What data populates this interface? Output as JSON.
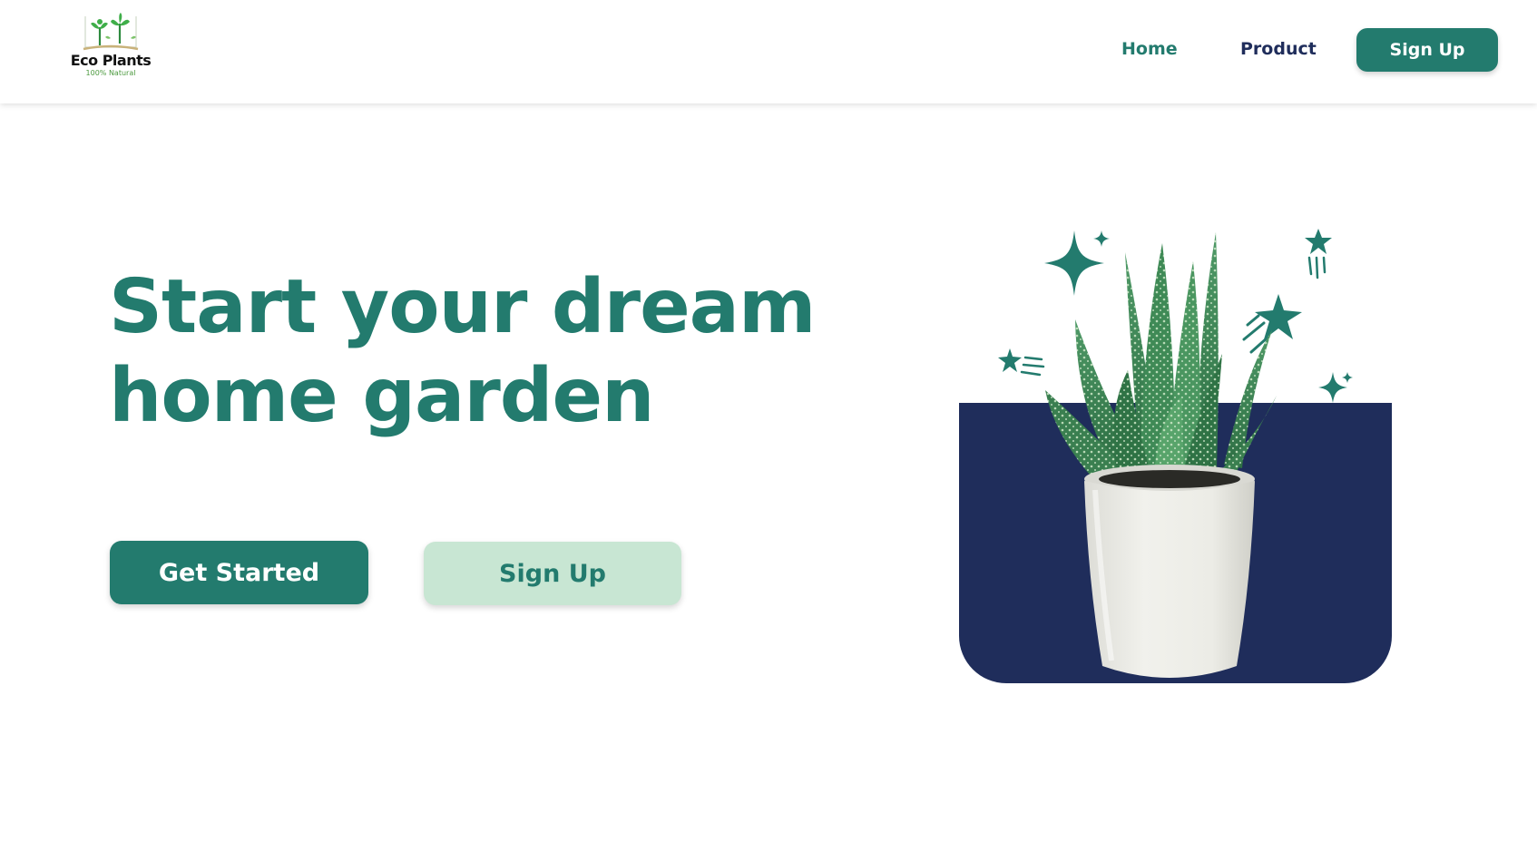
{
  "brand": {
    "name": "Eco Plants",
    "tagline": "100% Natural"
  },
  "nav": {
    "links": [
      {
        "label": "Home",
        "active": true
      },
      {
        "label": "Product",
        "active": false
      }
    ],
    "signup_label": "Sign Up"
  },
  "hero": {
    "title_line1": "Start your dream",
    "title_line2": "home garden",
    "primary_cta": "Get Started",
    "secondary_cta": "Sign Up"
  },
  "illustration": {
    "subject": "aloe plant in white concrete pot",
    "icons": [
      "sparkle-icon",
      "shooting-star-icon"
    ]
  },
  "colors": {
    "primary": "#237b6e",
    "navy": "#1f2d5b",
    "mint": "#c8e6d3",
    "background": "#ffffff"
  }
}
